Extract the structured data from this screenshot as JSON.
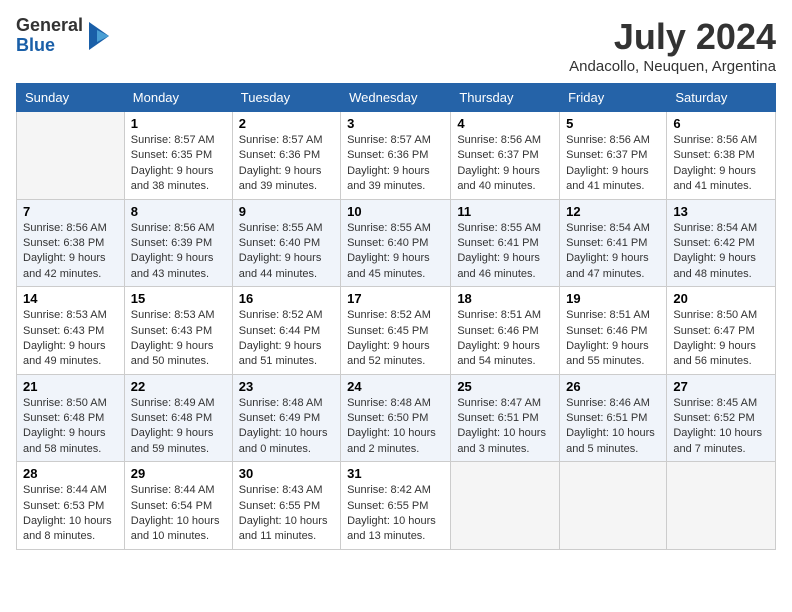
{
  "header": {
    "logo_general": "General",
    "logo_blue": "Blue",
    "month_year": "July 2024",
    "location": "Andacollo, Neuquen, Argentina"
  },
  "days_of_week": [
    "Sunday",
    "Monday",
    "Tuesday",
    "Wednesday",
    "Thursday",
    "Friday",
    "Saturday"
  ],
  "weeks": [
    [
      {
        "day": "",
        "empty": true
      },
      {
        "day": "1",
        "sunrise": "8:57 AM",
        "sunset": "6:35 PM",
        "daylight": "9 hours and 38 minutes."
      },
      {
        "day": "2",
        "sunrise": "8:57 AM",
        "sunset": "6:36 PM",
        "daylight": "9 hours and 39 minutes."
      },
      {
        "day": "3",
        "sunrise": "8:57 AM",
        "sunset": "6:36 PM",
        "daylight": "9 hours and 39 minutes."
      },
      {
        "day": "4",
        "sunrise": "8:56 AM",
        "sunset": "6:37 PM",
        "daylight": "9 hours and 40 minutes."
      },
      {
        "day": "5",
        "sunrise": "8:56 AM",
        "sunset": "6:37 PM",
        "daylight": "9 hours and 41 minutes."
      },
      {
        "day": "6",
        "sunrise": "8:56 AM",
        "sunset": "6:38 PM",
        "daylight": "9 hours and 41 minutes."
      }
    ],
    [
      {
        "day": "7",
        "sunrise": "8:56 AM",
        "sunset": "6:38 PM",
        "daylight": "9 hours and 42 minutes."
      },
      {
        "day": "8",
        "sunrise": "8:56 AM",
        "sunset": "6:39 PM",
        "daylight": "9 hours and 43 minutes."
      },
      {
        "day": "9",
        "sunrise": "8:55 AM",
        "sunset": "6:40 PM",
        "daylight": "9 hours and 44 minutes."
      },
      {
        "day": "10",
        "sunrise": "8:55 AM",
        "sunset": "6:40 PM",
        "daylight": "9 hours and 45 minutes."
      },
      {
        "day": "11",
        "sunrise": "8:55 AM",
        "sunset": "6:41 PM",
        "daylight": "9 hours and 46 minutes."
      },
      {
        "day": "12",
        "sunrise": "8:54 AM",
        "sunset": "6:41 PM",
        "daylight": "9 hours and 47 minutes."
      },
      {
        "day": "13",
        "sunrise": "8:54 AM",
        "sunset": "6:42 PM",
        "daylight": "9 hours and 48 minutes."
      }
    ],
    [
      {
        "day": "14",
        "sunrise": "8:53 AM",
        "sunset": "6:43 PM",
        "daylight": "9 hours and 49 minutes."
      },
      {
        "day": "15",
        "sunrise": "8:53 AM",
        "sunset": "6:43 PM",
        "daylight": "9 hours and 50 minutes."
      },
      {
        "day": "16",
        "sunrise": "8:52 AM",
        "sunset": "6:44 PM",
        "daylight": "9 hours and 51 minutes."
      },
      {
        "day": "17",
        "sunrise": "8:52 AM",
        "sunset": "6:45 PM",
        "daylight": "9 hours and 52 minutes."
      },
      {
        "day": "18",
        "sunrise": "8:51 AM",
        "sunset": "6:46 PM",
        "daylight": "9 hours and 54 minutes."
      },
      {
        "day": "19",
        "sunrise": "8:51 AM",
        "sunset": "6:46 PM",
        "daylight": "9 hours and 55 minutes."
      },
      {
        "day": "20",
        "sunrise": "8:50 AM",
        "sunset": "6:47 PM",
        "daylight": "9 hours and 56 minutes."
      }
    ],
    [
      {
        "day": "21",
        "sunrise": "8:50 AM",
        "sunset": "6:48 PM",
        "daylight": "9 hours and 58 minutes."
      },
      {
        "day": "22",
        "sunrise": "8:49 AM",
        "sunset": "6:48 PM",
        "daylight": "9 hours and 59 minutes."
      },
      {
        "day": "23",
        "sunrise": "8:48 AM",
        "sunset": "6:49 PM",
        "daylight": "10 hours and 0 minutes."
      },
      {
        "day": "24",
        "sunrise": "8:48 AM",
        "sunset": "6:50 PM",
        "daylight": "10 hours and 2 minutes."
      },
      {
        "day": "25",
        "sunrise": "8:47 AM",
        "sunset": "6:51 PM",
        "daylight": "10 hours and 3 minutes."
      },
      {
        "day": "26",
        "sunrise": "8:46 AM",
        "sunset": "6:51 PM",
        "daylight": "10 hours and 5 minutes."
      },
      {
        "day": "27",
        "sunrise": "8:45 AM",
        "sunset": "6:52 PM",
        "daylight": "10 hours and 7 minutes."
      }
    ],
    [
      {
        "day": "28",
        "sunrise": "8:44 AM",
        "sunset": "6:53 PM",
        "daylight": "10 hours and 8 minutes."
      },
      {
        "day": "29",
        "sunrise": "8:44 AM",
        "sunset": "6:54 PM",
        "daylight": "10 hours and 10 minutes."
      },
      {
        "day": "30",
        "sunrise": "8:43 AM",
        "sunset": "6:55 PM",
        "daylight": "10 hours and 11 minutes."
      },
      {
        "day": "31",
        "sunrise": "8:42 AM",
        "sunset": "6:55 PM",
        "daylight": "10 hours and 13 minutes."
      },
      {
        "day": "",
        "empty": true
      },
      {
        "day": "",
        "empty": true
      },
      {
        "day": "",
        "empty": true
      }
    ]
  ]
}
